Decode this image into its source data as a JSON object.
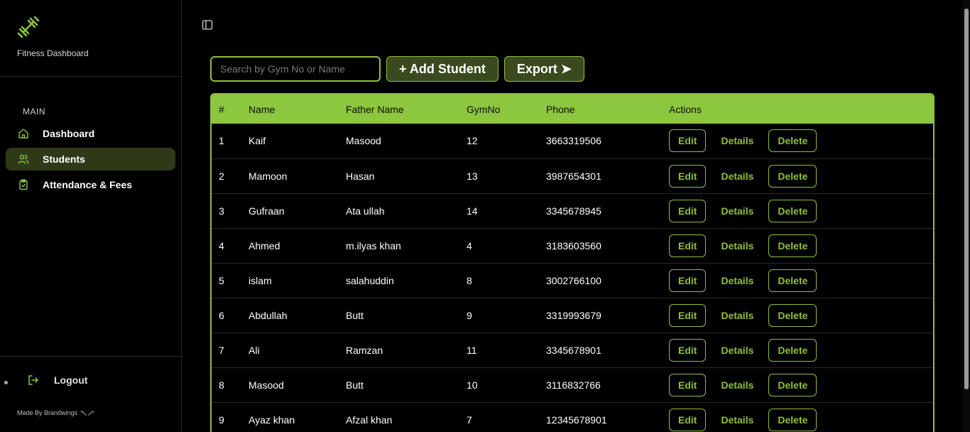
{
  "brand": {
    "name": "Fitness Dashboard",
    "logo_icon": "dumbbell-icon",
    "accent": "#8dc63f"
  },
  "sidebar": {
    "section": "MAIN",
    "items": [
      {
        "label": "Dashboard",
        "icon": "home-icon",
        "active": false
      },
      {
        "label": "Students",
        "icon": "users-icon",
        "active": true
      },
      {
        "label": "Attendance & Fees",
        "icon": "clipboard-icon",
        "active": false
      }
    ],
    "logout": "Logout",
    "made_by": "Made By Brandwings"
  },
  "toolbar": {
    "search_placeholder": "Search by Gym No or Name",
    "add_label": "+ Add Student",
    "export_label": "Export ➤"
  },
  "table": {
    "headers": [
      "#",
      "Name",
      "Father Name",
      "GymNo",
      "Phone",
      "Actions"
    ],
    "action_labels": {
      "edit": "Edit",
      "details": "Details",
      "delete": "Delete"
    },
    "rows": [
      {
        "n": "1",
        "name": "Kaif",
        "father": "Masood",
        "gym": "12",
        "phone": "3663319506"
      },
      {
        "n": "2",
        "name": "Mamoon",
        "father": "Hasan",
        "gym": "13",
        "phone": "3987654301"
      },
      {
        "n": "3",
        "name": "Gufraan",
        "father": "Ata ullah",
        "gym": "14",
        "phone": "3345678945"
      },
      {
        "n": "4",
        "name": "Ahmed",
        "father": "m.ilyas khan",
        "gym": "4",
        "phone": "3183603560"
      },
      {
        "n": "5",
        "name": "islam",
        "father": "salahuddin",
        "gym": "8",
        "phone": "3002766100"
      },
      {
        "n": "6",
        "name": "Abdullah",
        "father": "Butt",
        "gym": "9",
        "phone": "3319993679"
      },
      {
        "n": "7",
        "name": "Ali",
        "father": "Ramzan",
        "gym": "11",
        "phone": "3345678901"
      },
      {
        "n": "8",
        "name": "Masood",
        "father": "Butt",
        "gym": "10",
        "phone": "3116832766"
      },
      {
        "n": "9",
        "name": "Ayaz khan",
        "father": "Afzal khan",
        "gym": "7",
        "phone": "12345678901"
      }
    ]
  }
}
